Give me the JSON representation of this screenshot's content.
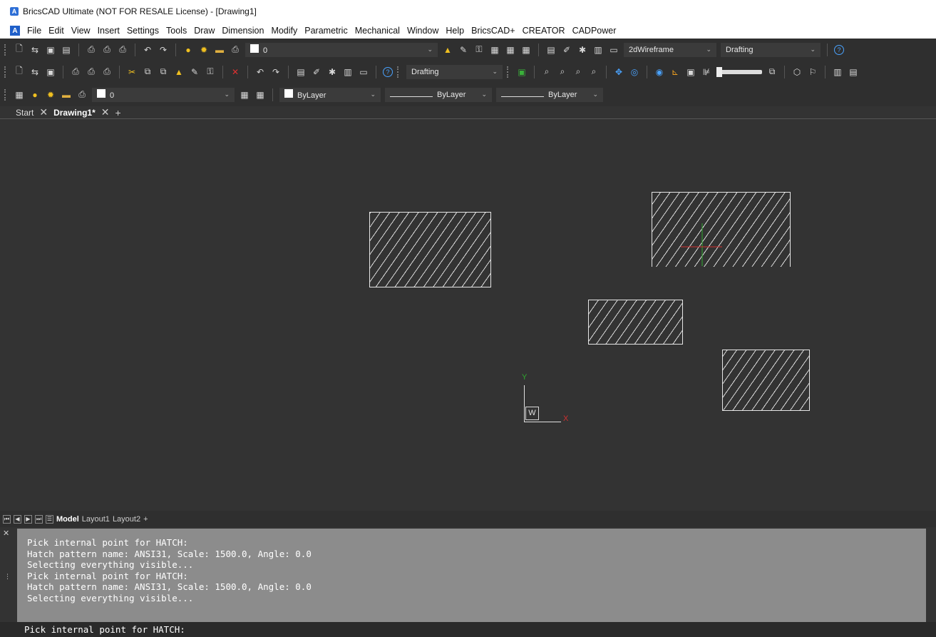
{
  "window": {
    "title": "BricsCAD Ultimate (NOT FOR RESALE License) - [Drawing1]"
  },
  "menubar": {
    "items": [
      "File",
      "Edit",
      "View",
      "Insert",
      "Settings",
      "Tools",
      "Draw",
      "Dimension",
      "Modify",
      "Parametric",
      "Mechanical",
      "Window",
      "Help",
      "BricsCAD+",
      "CREATOR",
      "CADPower"
    ]
  },
  "toolbar1": {
    "layer_value": "0",
    "visual_style": "2dWireframe",
    "workspace": "Drafting"
  },
  "toolbar2": {
    "workspace": "Drafting"
  },
  "toolbar3": {
    "layer_value": "0",
    "color": "ByLayer",
    "linetype": "ByLayer",
    "lineweight": "ByLayer"
  },
  "doc_tabs": {
    "start": "Start",
    "active": "Drawing1*",
    "add": "+"
  },
  "ucs": {
    "y_label": "Y",
    "x_label": "X",
    "w_label": "W"
  },
  "layout_tabs": {
    "items": [
      "Model",
      "Layout1",
      "Layout2"
    ],
    "add": "+"
  },
  "command": {
    "history": [
      "Pick internal point for HATCH:",
      "Hatch pattern name: ANSI31, Scale: 1500.0, Angle: 0.0",
      "Selecting everything visible...",
      "Pick internal point for HATCH:",
      "Hatch pattern name: ANSI31, Scale: 1500.0, Angle: 0.0",
      "Selecting everything visible..."
    ],
    "prompt": "Pick internal point for HATCH:"
  },
  "colors": {
    "canvas": "#333333",
    "toolbar": "#2f2f2f",
    "command_history_bg": "#8c8c8c",
    "crosshair_x": "#d03030",
    "crosshair_y": "#2fa82f"
  }
}
